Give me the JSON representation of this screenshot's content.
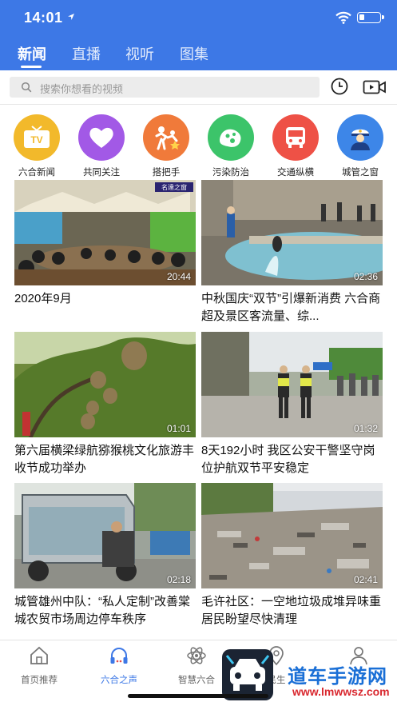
{
  "status_bar": {
    "time": "14:01"
  },
  "tabs": [
    {
      "label": "新闻",
      "active": true
    },
    {
      "label": "直播",
      "active": false
    },
    {
      "label": "视听",
      "active": false
    },
    {
      "label": "图集",
      "active": false
    }
  ],
  "search": {
    "placeholder": "搜索你想看的视频"
  },
  "icons": {
    "history": "history-clock-icon",
    "video": "video-camera-icon"
  },
  "categories": [
    {
      "label": "六合新闻",
      "icon": "tv-icon",
      "color": "#f2b92b",
      "icon_text": "TV"
    },
    {
      "label": "共同关注",
      "icon": "heart-icon",
      "color": "#a259e6"
    },
    {
      "label": "搭把手",
      "icon": "helping-hand-icon",
      "color": "#f07a3a"
    },
    {
      "label": "污染防治",
      "icon": "pollution-icon",
      "color": "#3cc46a"
    },
    {
      "label": "交通纵横",
      "icon": "bus-icon",
      "color": "#ee5146"
    },
    {
      "label": "城管之窗",
      "icon": "officer-icon",
      "color": "#3d86e8"
    }
  ],
  "videos": [
    {
      "title": "2020年9月",
      "duration": "20:44",
      "overlay_text": "名達之窗"
    },
    {
      "title": "中秋国庆“双节”引爆新消费 六合商超及景区客流量、综...",
      "duration": "02:36"
    },
    {
      "title": "第六届横梁绿航猕猴桃文化旅游丰收节成功举办",
      "duration": "01:01"
    },
    {
      "title": "8天192小时 我区公安干警坚守岗位护航双节平安稳定",
      "duration": "01:32"
    },
    {
      "title": "城管雄州中队：“私人定制”改善棠城农贸市场周边停车秩序",
      "duration": "02:18"
    },
    {
      "title": "毛许社区：一空地垃圾成堆异味重 居民盼望尽快清理",
      "duration": "02:41"
    }
  ],
  "bottom_nav": [
    {
      "label": "首页推荐",
      "icon": "home-icon",
      "active": false
    },
    {
      "label": "六合之声",
      "icon": "headphones-icon",
      "active": true
    },
    {
      "label": "智慧六合",
      "icon": "atom-icon",
      "active": false
    },
    {
      "label": "民生",
      "icon": "location-icon",
      "active": false
    },
    {
      "label": "",
      "icon": "user-icon",
      "active": false
    }
  ],
  "watermark": {
    "title": "道车手游网",
    "url": "www.lmwwsz.com"
  },
  "colors": {
    "brand_blue": "#3d78e6",
    "active_nav": "#3d78e6"
  }
}
